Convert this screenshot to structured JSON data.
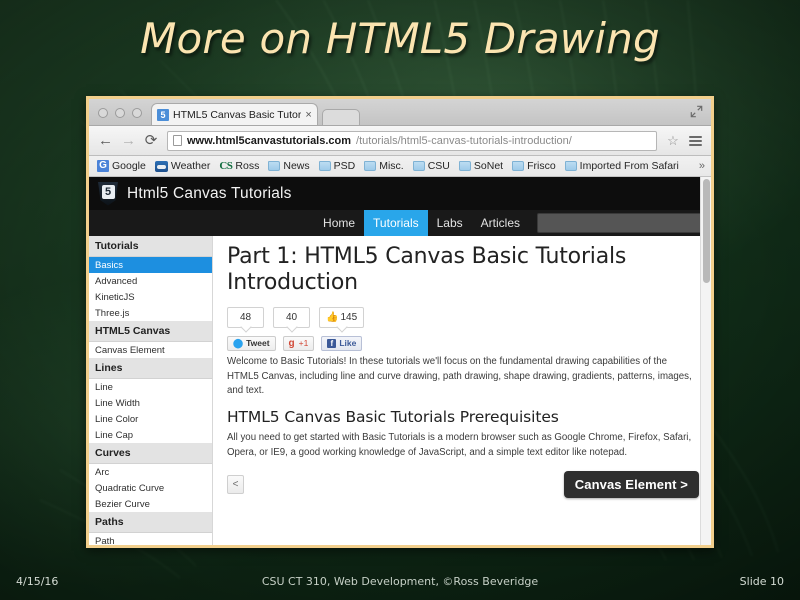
{
  "slide": {
    "title": "More on HTML5 Drawing",
    "footer": {
      "date": "4/15/16",
      "center": "CSU CT 310, Web Development, ©Ross Beveridge",
      "slide_number": "Slide 10"
    },
    "background_color": "#16371d",
    "title_color": "#fbe4b0",
    "frame_color": "#f2cf8c"
  },
  "browser": {
    "window_controls": [
      "close",
      "minimize",
      "zoom"
    ],
    "fullscreen_icon": "fullscreen-icon",
    "tab": {
      "favicon": "html5-favicon",
      "favicon_label": "5",
      "title": "HTML5 Canvas Basic Tutor",
      "close_label": "×"
    },
    "toolbar": {
      "back_label": "←",
      "forward_label": "→",
      "reload_label": "⟳",
      "page_icon": "page-icon",
      "url_host": "www.html5canvastutorials.com",
      "url_path": "/tutorials/html5-canvas-tutorials-introduction/",
      "star_label": "☆",
      "menu_icon": "hamburger-menu-icon"
    },
    "bookmarks": [
      {
        "label": "Google",
        "icon": "google-icon"
      },
      {
        "label": "Weather",
        "icon": "weather-icon"
      },
      {
        "label": "Ross",
        "icon": "ross-icon"
      },
      {
        "label": "News",
        "icon": "folder-icon"
      },
      {
        "label": "PSD",
        "icon": "folder-icon"
      },
      {
        "label": "Misc.",
        "icon": "folder-icon"
      },
      {
        "label": "CSU",
        "icon": "folder-icon"
      },
      {
        "label": "SoNet",
        "icon": "folder-icon"
      },
      {
        "label": "Frisco",
        "icon": "folder-icon"
      },
      {
        "label": "Imported From Safari",
        "icon": "folder-icon"
      }
    ],
    "bookmarks_overflow": "»"
  },
  "site": {
    "logo_label": "5",
    "title": "Html5 Canvas Tutorials",
    "nav": [
      {
        "label": "Home",
        "active": false
      },
      {
        "label": "Tutorials",
        "active": true
      },
      {
        "label": "Labs",
        "active": false
      },
      {
        "label": "Articles",
        "active": false
      }
    ],
    "search_value": "",
    "search_placeholder": "",
    "accent_color": "#29a6ea",
    "header_color": "#0d0d0d"
  },
  "sidebar": {
    "sections": [
      {
        "heading": "Tutorials",
        "items": [
          {
            "label": "Basics",
            "active": true
          },
          {
            "label": "Advanced",
            "active": false
          },
          {
            "label": "KineticJS",
            "active": false
          },
          {
            "label": "Three.js",
            "active": false
          }
        ]
      },
      {
        "heading": "HTML5 Canvas",
        "items": [
          {
            "label": "Canvas Element",
            "active": false
          }
        ]
      },
      {
        "heading": "Lines",
        "items": [
          {
            "label": "Line",
            "active": false
          },
          {
            "label": "Line Width",
            "active": false
          },
          {
            "label": "Line Color",
            "active": false
          },
          {
            "label": "Line Cap",
            "active": false
          }
        ]
      },
      {
        "heading": "Curves",
        "items": [
          {
            "label": "Arc",
            "active": false
          },
          {
            "label": "Quadratic Curve",
            "active": false
          },
          {
            "label": "Bezier Curve",
            "active": false
          }
        ]
      },
      {
        "heading": "Paths",
        "items": [
          {
            "label": "Path",
            "active": false
          }
        ]
      }
    ]
  },
  "main": {
    "h1": "Part 1: HTML5 Canvas Basic Tutorials Introduction",
    "social": {
      "counts": [
        {
          "value": "48",
          "icon": null
        },
        {
          "value": "40",
          "icon": null
        },
        {
          "value": "145",
          "icon": "thumbs-up-icon"
        }
      ],
      "tweet_label": "Tweet",
      "gplus_label": "+1",
      "like_label": "Like"
    },
    "paragraph_1": "Welcome to Basic Tutorials! In these tutorials we'll focus on the fundamental drawing capabilities of the HTML5 Canvas, including line and curve drawing, path drawing, shape drawing, gradients, patterns, images, and text.",
    "h2": "HTML5 Canvas Basic Tutorials Prerequisites",
    "paragraph_2": "All you need to get started with Basic Tutorials is a modern browser such as Google Chrome, Firefox, Safari, Opera, or IE9, a good working knowledge of JavaScript, and a simple text editor like notepad.",
    "prev_label": "<",
    "next_label": "Canvas Element >"
  }
}
